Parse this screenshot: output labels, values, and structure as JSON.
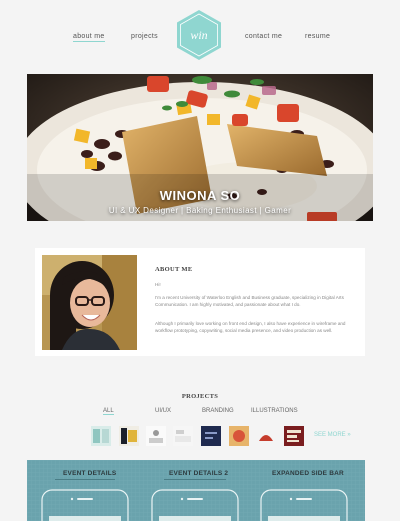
{
  "nav": {
    "about": "about me",
    "projects": "projects",
    "contact": "contact me",
    "resume": "resume",
    "logo_text": "win"
  },
  "hero": {
    "name": "WINONA SO",
    "tagline": "UI & UX Designer | Baking Enthusiast | Gamer"
  },
  "about": {
    "title": "ABOUT ME",
    "greeting": "Hi!",
    "para1": "I'm a recent University of Waterloo English and Business graduate, specializing in Digital Arts Communication. I am highly motivated, and passionate about what I do.",
    "para2": "Although I primarily love working on front end design, I also have experience in wireframe and workflow prototyping, copywriting, social media presence, and video production as well."
  },
  "projects": {
    "title": "PROJECTS",
    "filters": [
      "ALL",
      "UI/UX",
      "BRANDING",
      "ILLUSTRATIONS"
    ],
    "see_more": "SEE MORE »"
  },
  "showcase": {
    "labels": [
      "EVENT DETAILS",
      "EVENT DETAILS 2",
      "EXPANDED SIDE BAR"
    ]
  },
  "colors": {
    "accent": "#8fd6d0",
    "showcase_bg": "#6aa3ad",
    "background": "#f4f4f4"
  }
}
